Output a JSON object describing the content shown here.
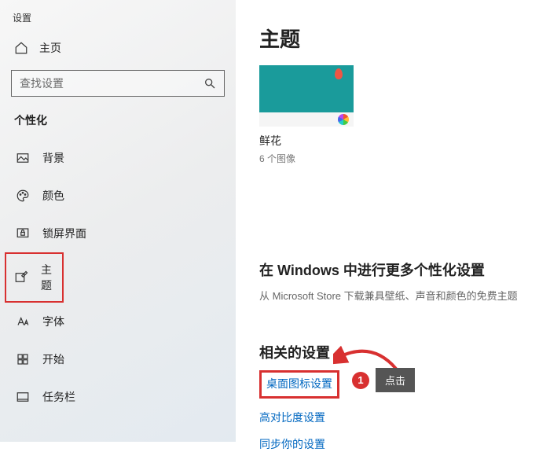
{
  "window_title": "设置",
  "home_label": "主页",
  "search_placeholder": "查找设置",
  "sidebar_section": "个性化",
  "nav": {
    "background": "背景",
    "colors": "颜色",
    "lockscreen": "锁屏界面",
    "themes": "主题",
    "fonts": "字体",
    "start": "开始",
    "taskbar": "任务栏"
  },
  "main": {
    "title": "主题",
    "theme_name": "鲜花",
    "theme_count": "6 个图像",
    "more_heading": "在 Windows 中进行更多个性化设置",
    "more_sub": "从 Microsoft Store 下载兼具壁纸、声音和颜色的免费主题",
    "related_heading": "相关的设置",
    "link_desktop_icons": "桌面图标设置",
    "link_high_contrast": "高对比度设置",
    "link_sync": "同步你的设置"
  },
  "annotation": {
    "number": "1",
    "tooltip": "点击"
  }
}
